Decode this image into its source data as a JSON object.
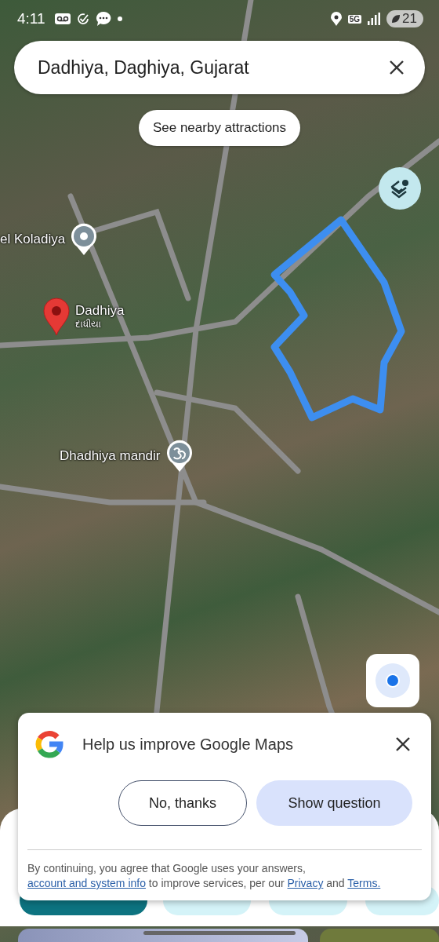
{
  "status_bar": {
    "time": "4:11",
    "network": "5G",
    "battery": "21"
  },
  "search": {
    "value": "Dadhiya, Daghiya, Gujarat"
  },
  "chip": "See nearby attractions",
  "map_labels": [
    {
      "kind": "place",
      "text": "el Koladiya"
    },
    {
      "kind": "pin",
      "text": "Dadhiya",
      "subtext": "દાધીયા"
    },
    {
      "kind": "temple",
      "text": "Dhadhiya mandir"
    }
  ],
  "survey": {
    "title": "Help us improve Google Maps",
    "buttons": [
      {
        "kind": "outline",
        "label": "No, thanks"
      },
      {
        "kind": "filled",
        "label": "Show question"
      }
    ],
    "footer": [
      {
        "kind": "text",
        "text": "By continuing, you agree that Google uses your answers, "
      },
      {
        "kind": "link",
        "text": "account and system info"
      },
      {
        "kind": "text",
        "text": " to improve services, per our "
      },
      {
        "kind": "link",
        "text": "Privacy"
      },
      {
        "kind": "text",
        "text": " and "
      },
      {
        "kind": "link",
        "text": "Terms."
      }
    ]
  }
}
